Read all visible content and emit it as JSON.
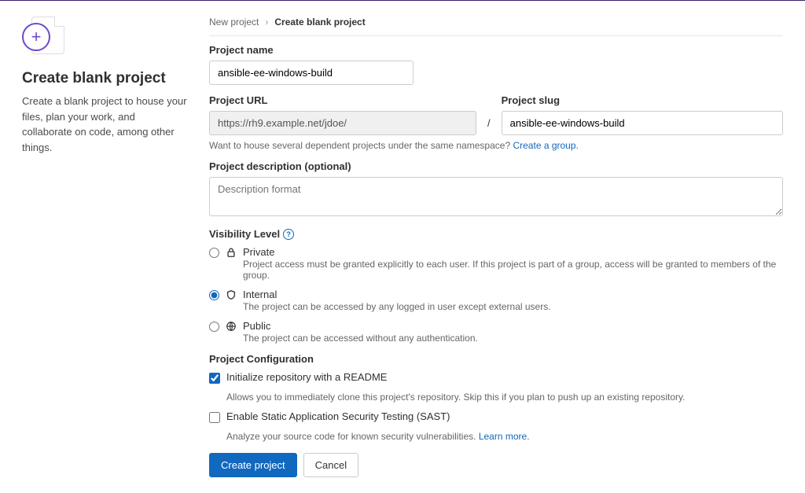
{
  "sidebar": {
    "heading": "Create blank project",
    "description": "Create a blank project to house your files, plan your work, and collaborate on code, among other things."
  },
  "breadcrumb": {
    "parent": "New project",
    "current": "Create blank project"
  },
  "form": {
    "project_name_label": "Project name",
    "project_name_value": "ansible-ee-windows-build",
    "project_url_label": "Project URL",
    "project_url_value": "https://rh9.example.net/jdoe/",
    "slash": "/",
    "project_slug_label": "Project slug",
    "project_slug_value": "ansible-ee-windows-build",
    "namespace_hint": "Want to house several dependent projects under the same namespace? ",
    "namespace_link": "Create a group.",
    "description_label": "Project description (optional)",
    "description_placeholder": "Description format"
  },
  "visibility": {
    "heading": "Visibility Level",
    "options": [
      {
        "key": "private",
        "label": "Private",
        "desc": "Project access must be granted explicitly to each user. If this project is part of a group, access will be granted to members of the group.",
        "selected": false
      },
      {
        "key": "internal",
        "label": "Internal",
        "desc": "The project can be accessed by any logged in user except external users.",
        "selected": true
      },
      {
        "key": "public",
        "label": "Public",
        "desc": "The project can be accessed without any authentication.",
        "selected": false
      }
    ]
  },
  "config": {
    "heading": "Project Configuration",
    "readme_label": "Initialize repository with a README",
    "readme_desc": "Allows you to immediately clone this project's repository. Skip this if you plan to push up an existing repository.",
    "readme_checked": true,
    "sast_label": "Enable Static Application Security Testing (SAST)",
    "sast_desc": "Analyze your source code for known security vulnerabilities. ",
    "sast_link": "Learn more.",
    "sast_checked": false
  },
  "actions": {
    "create": "Create project",
    "cancel": "Cancel"
  }
}
